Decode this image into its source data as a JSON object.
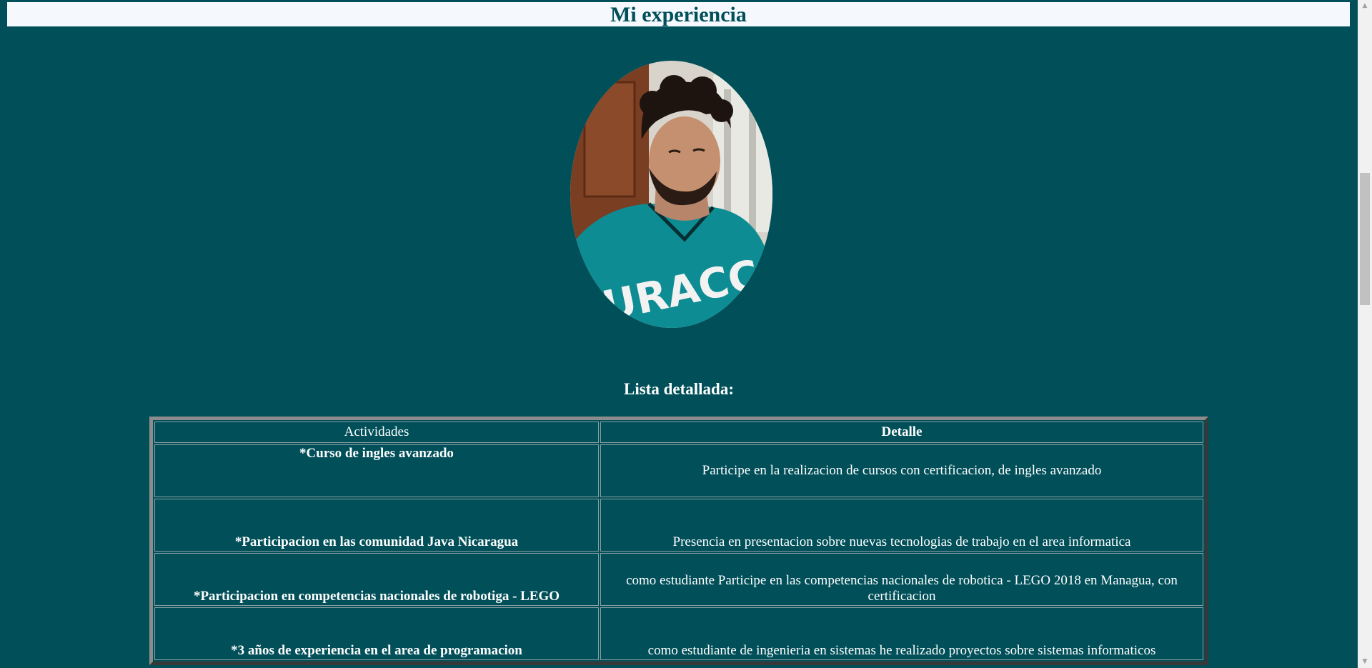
{
  "header": {
    "title": "Mi experiencia"
  },
  "profile_photo": {
    "icon": "person-photo"
  },
  "section": {
    "heading": "Lista detallada:"
  },
  "table": {
    "headers": [
      "Actividades",
      "Detalle"
    ],
    "rows": [
      {
        "activity": "*Curso de ingles avanzado",
        "detail": "Participe en la realizacion de cursos con certificacion, de ingles avanzado"
      },
      {
        "activity": "*Participacion en las comunidad Java Nicaragua",
        "detail": "Presencia en presentacion sobre nuevas tecnologias de trabajo en el area informatica"
      },
      {
        "activity": "*Participacion en competencias nacionales de robotiga - LEGO",
        "detail": "como estudiante Participe en las competencias nacionales de robotica - LEGO 2018 en Managua, con certificacion"
      },
      {
        "activity": "*3 años de experiencia en el area de programacion",
        "detail": "como estudiante de ingenieria en sistemas he realizado proyectos sobre sistemas informaticos"
      }
    ]
  },
  "colors": {
    "background": "#004f59",
    "title_bar": "#f5f8fd",
    "text": "#ffffff"
  },
  "scrollbar": {
    "up_icon": "scroll-up-arrow",
    "down_icon": "scroll-down-arrow"
  }
}
